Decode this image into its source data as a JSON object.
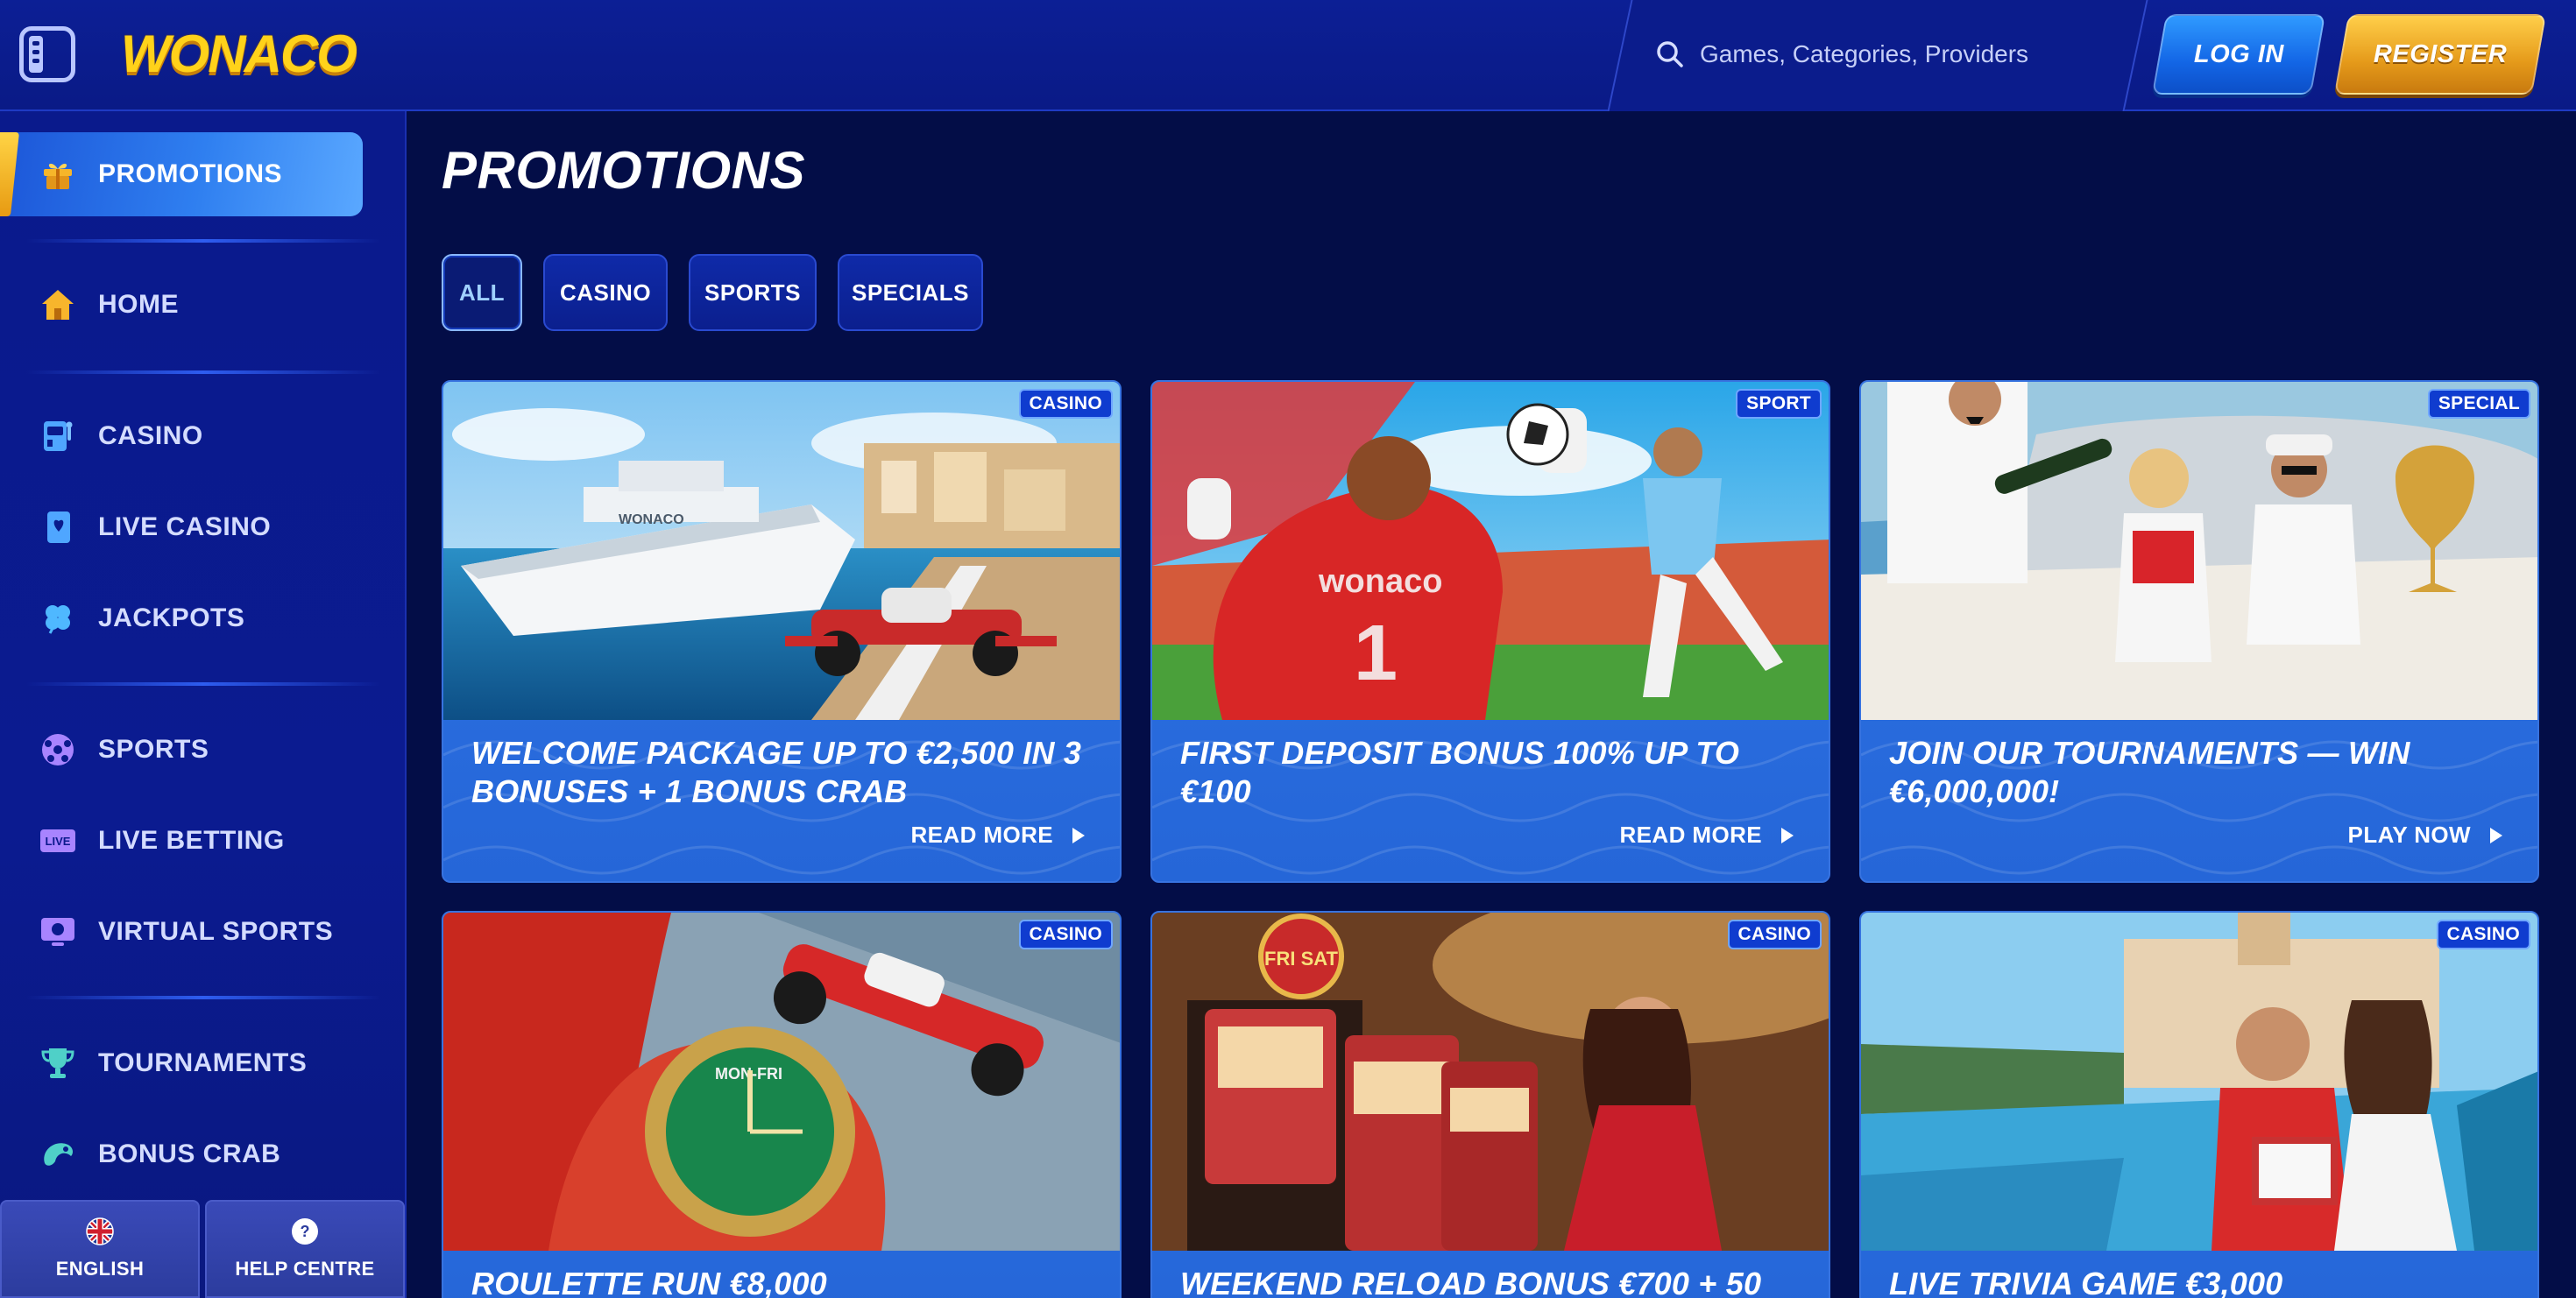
{
  "header": {
    "logo_text": "WONACO",
    "search": {
      "placeholder": "Games, Categories, Providers",
      "value": ""
    },
    "login_label": "LOG IN",
    "register_label": "REGISTER"
  },
  "sidebar": {
    "items": [
      {
        "label": "PROMOTIONS",
        "icon": "gift-icon",
        "active": true
      },
      {
        "label": "HOME",
        "icon": "home-icon"
      },
      {
        "label": "CASINO",
        "icon": "slot-machine-icon"
      },
      {
        "label": "LIVE CASINO",
        "icon": "playing-card-icon"
      },
      {
        "label": "JACKPOTS",
        "icon": "clover-icon"
      },
      {
        "label": "SPORTS",
        "icon": "soccer-ball-icon"
      },
      {
        "label": "LIVE BETTING",
        "icon": "live-badge-icon"
      },
      {
        "label": "VIRTUAL SPORTS",
        "icon": "virtual-screen-icon"
      },
      {
        "label": "TOURNAMENTS",
        "icon": "trophy-icon"
      },
      {
        "label": "BONUS CRAB",
        "icon": "crab-icon"
      }
    ],
    "footer": {
      "language_label": "ENGLISH",
      "help_label": "HELP CENTRE",
      "help_icon_glyph": "?"
    }
  },
  "main": {
    "title": "PROMOTIONS",
    "tabs": [
      {
        "label": "ALL",
        "active": true
      },
      {
        "label": "CASINO"
      },
      {
        "label": "SPORTS"
      },
      {
        "label": "SPECIALS"
      }
    ],
    "cards": [
      {
        "badge": "CASINO",
        "title": "WELCOME PACKAGE UP TO €2,500 IN 3 BONUSES + 1 BONUS CRAB",
        "cta": "READ MORE",
        "image": "yacht-and-race-car"
      },
      {
        "badge": "SPORT",
        "title": "FIRST DEPOSIT BONUS 100% UP TO €100",
        "cta": "READ MORE",
        "image": "goalkeeper-stadium",
        "jersey_text": "wonaco",
        "jersey_number": "1"
      },
      {
        "badge": "SPECIAL",
        "title": "JOIN OUR TOURNAMENTS — WIN €6,000,000!",
        "cta": "PLAY NOW",
        "image": "champagne-couple-trophy"
      },
      {
        "badge": "CASINO",
        "title": "ROULETTE RUN €8,000",
        "cta": "",
        "image": "watch-and-race-car"
      },
      {
        "badge": "CASINO",
        "title": "WEEKEND RELOAD BONUS €700 + 50",
        "cta": "",
        "image": "woman-slot-machines",
        "sign_text": "FRI SAT"
      },
      {
        "badge": "CASINO",
        "title": "LIVE TRIVIA GAME €3,000",
        "cta": "",
        "image": "couple-by-pool"
      }
    ]
  },
  "colors": {
    "page_bg": "#030d47",
    "header_bg": "#0c1f95",
    "sidebar_bg": "#0a1a8c",
    "card_bg": "#2566d8",
    "login_blue": "#1366e6",
    "register_gold": "#e59a1a",
    "logo_yellow": "#ffd21a"
  }
}
